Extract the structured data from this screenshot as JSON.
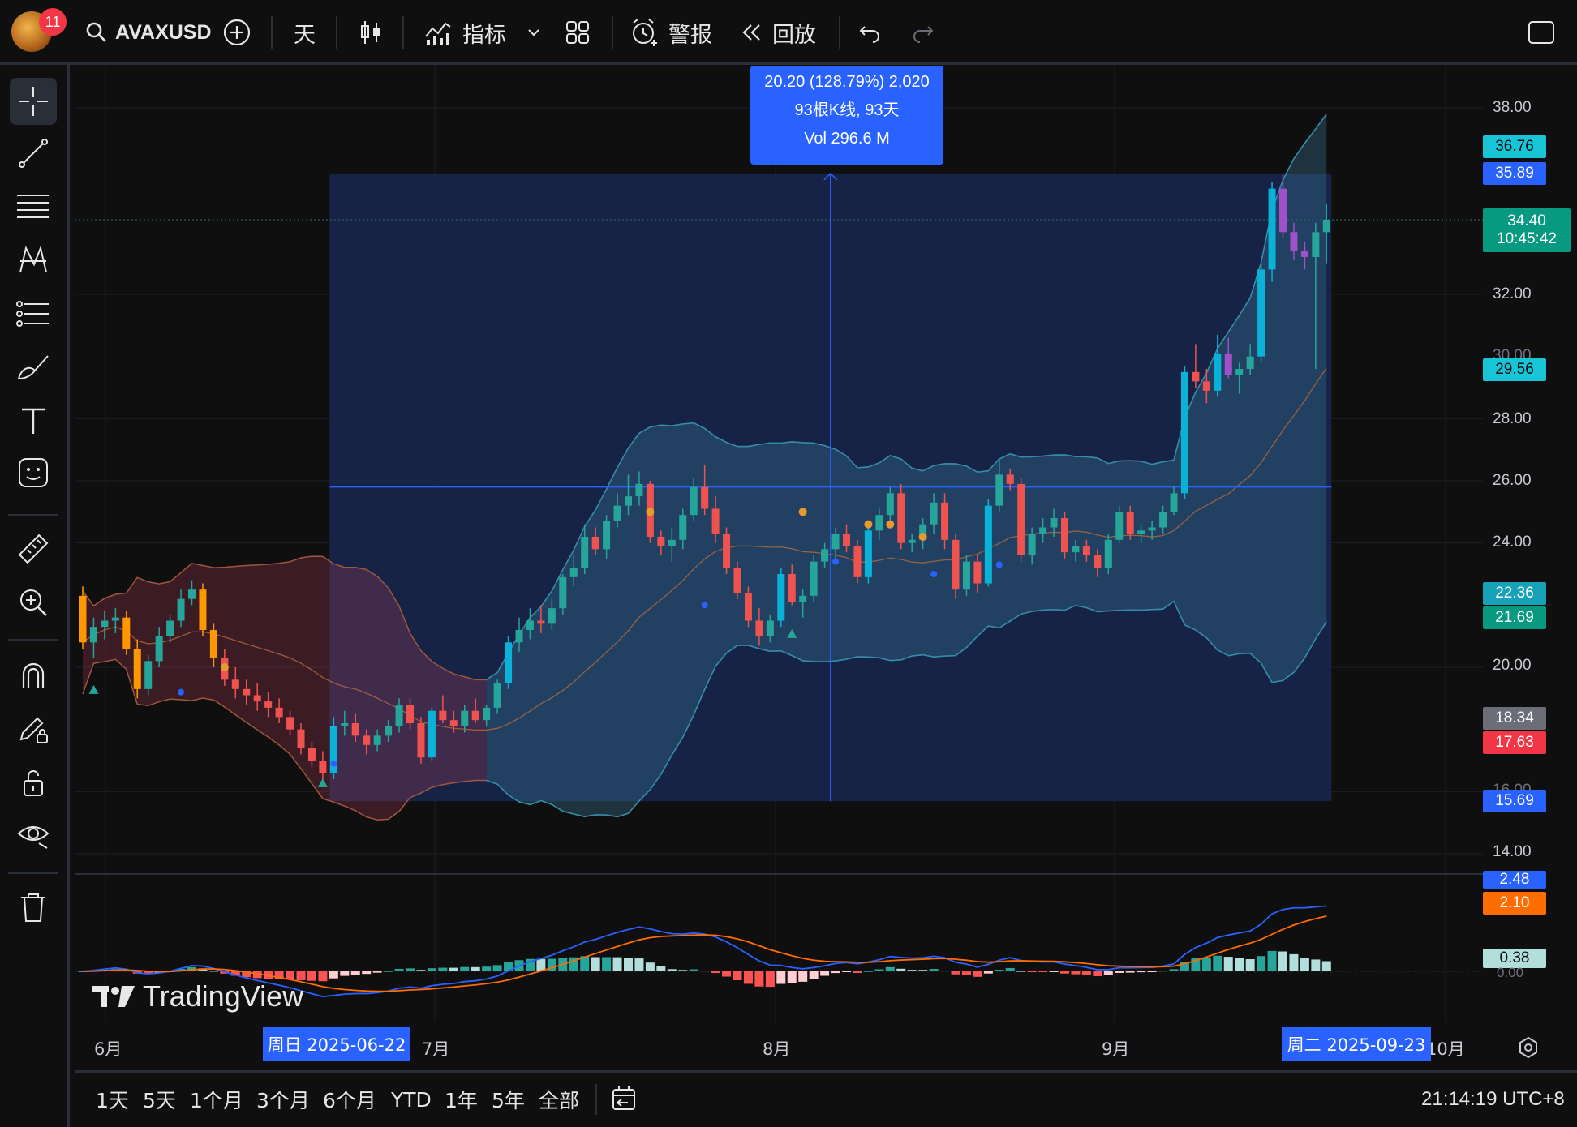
{
  "toolbar": {
    "notification_count": "11",
    "symbol": "AVAXUSD",
    "interval": "天",
    "indicators_label": "指标",
    "alert_label": "警报",
    "replay_label": "回放"
  },
  "measure": {
    "line1": "20.20 (128.79%) 2,020",
    "line2": "93根K线, 93天",
    "line3": "Vol 296.6 M"
  },
  "price_axis": {
    "ticks": [
      "38.00",
      "32.00",
      "30.00",
      "28.00",
      "26.00",
      "24.00",
      "20.00",
      "16.00",
      "14.00"
    ],
    "tags": {
      "t1": "36.76",
      "t2": "35.89",
      "t3": "34.40",
      "t3b": "10:45:42",
      "t4": "29.56",
      "t5": "22.36",
      "t6": "21.69",
      "t7": "18.34",
      "t8": "17.63",
      "t9": "15.69"
    },
    "macd_tags": {
      "m1": "2.48",
      "m2": "2.10",
      "m3": "0.38",
      "m4": "0.00"
    }
  },
  "time_axis": {
    "labels": [
      "6月",
      "7月",
      "8月",
      "9月",
      "10月"
    ],
    "range_start": "周日 2025-06-22",
    "range_end": "周二 2025-09-23"
  },
  "watermark": "TradingView",
  "bottom": {
    "ranges": [
      "1天",
      "5天",
      "1个月",
      "3个月",
      "6个月",
      "YTD",
      "1年",
      "5年",
      "全部"
    ],
    "clock": "21:14:19 UTC+8"
  },
  "colors": {
    "up": "#26a69a",
    "down": "#ef5350",
    "cyan": "#0ab2d8",
    "purple": "#a050c8",
    "orange": "#ff9800",
    "blue": "#2962ff",
    "measure_fill": "#17254a"
  },
  "chart_data": {
    "type": "candlestick",
    "symbol": "AVAXUSD",
    "range": {
      "start": "2025-06-22",
      "end": "2025-09-23"
    },
    "measure": {
      "change": 20.2,
      "change_pct": 128.79,
      "bars": 93,
      "days": 93,
      "volume": "296.6 M"
    },
    "candles": [
      [
        22.3,
        22.6,
        20.6,
        20.8
      ],
      [
        20.8,
        21.6,
        20.3,
        21.3
      ],
      [
        21.3,
        21.8,
        20.9,
        21.5
      ],
      [
        21.5,
        21.9,
        21.1,
        21.6
      ],
      [
        21.6,
        21.8,
        20.4,
        20.6
      ],
      [
        20.6,
        20.9,
        19.0,
        19.3
      ],
      [
        19.3,
        20.4,
        19.1,
        20.2
      ],
      [
        20.2,
        21.3,
        20.0,
        21.0
      ],
      [
        21.0,
        21.7,
        20.8,
        21.5
      ],
      [
        21.5,
        22.5,
        21.3,
        22.2
      ],
      [
        22.2,
        22.8,
        22.0,
        22.5
      ],
      [
        22.5,
        22.7,
        21.0,
        21.2
      ],
      [
        21.2,
        21.4,
        20.0,
        20.3
      ],
      [
        20.3,
        20.6,
        19.4,
        19.6
      ],
      [
        19.6,
        20.0,
        19.0,
        19.3
      ],
      [
        19.3,
        19.6,
        18.8,
        19.1
      ],
      [
        19.1,
        19.5,
        18.6,
        18.9
      ],
      [
        18.9,
        19.2,
        18.4,
        18.7
      ],
      [
        18.7,
        19.0,
        18.2,
        18.4
      ],
      [
        18.4,
        18.6,
        17.8,
        18.0
      ],
      [
        18.0,
        18.2,
        17.2,
        17.4
      ],
      [
        17.4,
        17.6,
        16.8,
        17.0
      ],
      [
        17.0,
        17.3,
        16.3,
        16.6
      ],
      [
        16.6,
        18.4,
        16.4,
        18.1
      ],
      [
        18.1,
        18.6,
        17.8,
        18.2
      ],
      [
        18.2,
        18.5,
        17.6,
        17.8
      ],
      [
        17.8,
        18.0,
        17.2,
        17.5
      ],
      [
        17.5,
        18.0,
        17.3,
        17.8
      ],
      [
        17.8,
        18.3,
        17.6,
        18.1
      ],
      [
        18.1,
        19.0,
        17.9,
        18.8
      ],
      [
        18.8,
        19.0,
        18.0,
        18.2
      ],
      [
        18.2,
        18.4,
        16.9,
        17.1
      ],
      [
        17.1,
        18.7,
        17.0,
        18.6
      ],
      [
        18.6,
        19.1,
        18.2,
        18.3
      ],
      [
        18.3,
        18.6,
        17.9,
        18.1
      ],
      [
        18.1,
        18.8,
        17.9,
        18.6
      ],
      [
        18.6,
        19.0,
        18.2,
        18.3
      ],
      [
        18.3,
        18.8,
        18.1,
        18.7
      ],
      [
        18.7,
        19.6,
        18.5,
        19.5
      ],
      [
        19.5,
        21.0,
        19.3,
        20.8
      ],
      [
        20.8,
        21.6,
        20.5,
        21.2
      ],
      [
        21.2,
        21.9,
        20.9,
        21.5
      ],
      [
        21.5,
        22.0,
        21.1,
        21.4
      ],
      [
        21.4,
        22.2,
        21.2,
        21.9
      ],
      [
        21.9,
        23.0,
        21.7,
        22.9
      ],
      [
        22.9,
        23.6,
        22.6,
        23.2
      ],
      [
        23.2,
        24.6,
        23.0,
        24.2
      ],
      [
        24.2,
        24.5,
        23.6,
        23.8
      ],
      [
        23.8,
        24.9,
        23.5,
        24.7
      ],
      [
        24.7,
        25.6,
        24.5,
        25.2
      ],
      [
        25.2,
        26.2,
        24.9,
        25.5
      ],
      [
        25.5,
        26.3,
        25.2,
        25.9
      ],
      [
        25.9,
        26.0,
        24.0,
        24.2
      ],
      [
        24.2,
        24.4,
        23.6,
        23.9
      ],
      [
        23.9,
        24.5,
        23.4,
        24.1
      ],
      [
        24.1,
        25.1,
        23.8,
        24.9
      ],
      [
        24.9,
        26.1,
        24.7,
        25.8
      ],
      [
        25.8,
        26.5,
        24.9,
        25.1
      ],
      [
        25.1,
        25.5,
        24.0,
        24.3
      ],
      [
        24.3,
        24.5,
        23.0,
        23.2
      ],
      [
        23.2,
        23.4,
        22.2,
        22.4
      ],
      [
        22.4,
        22.6,
        21.3,
        21.5
      ],
      [
        21.5,
        21.9,
        20.7,
        21.0
      ],
      [
        21.0,
        21.7,
        20.8,
        21.5
      ],
      [
        21.5,
        23.2,
        21.3,
        23.0
      ],
      [
        23.0,
        23.3,
        22.0,
        22.1
      ],
      [
        22.1,
        22.5,
        21.6,
        22.3
      ],
      [
        22.3,
        23.6,
        22.1,
        23.4
      ],
      [
        23.4,
        24.0,
        23.2,
        23.8
      ],
      [
        23.8,
        24.5,
        23.5,
        24.3
      ],
      [
        24.3,
        24.6,
        23.7,
        23.9
      ],
      [
        23.9,
        24.1,
        22.7,
        22.9
      ],
      [
        22.9,
        24.6,
        22.7,
        24.4
      ],
      [
        24.4,
        25.1,
        24.1,
        24.9
      ],
      [
        24.9,
        25.8,
        24.6,
        25.6
      ],
      [
        25.6,
        25.9,
        23.8,
        24.0
      ],
      [
        24.0,
        24.3,
        23.7,
        24.1
      ],
      [
        24.1,
        24.8,
        23.8,
        24.6
      ],
      [
        24.6,
        25.6,
        24.3,
        25.3
      ],
      [
        25.3,
        25.6,
        23.8,
        24.1
      ],
      [
        24.1,
        24.3,
        22.2,
        22.5
      ],
      [
        22.5,
        23.6,
        22.3,
        23.4
      ],
      [
        23.4,
        23.6,
        22.4,
        22.7
      ],
      [
        22.7,
        25.4,
        22.6,
        25.2
      ],
      [
        25.2,
        26.7,
        25.0,
        26.2
      ],
      [
        26.2,
        26.4,
        25.7,
        25.9
      ],
      [
        25.9,
        26.1,
        23.4,
        23.6
      ],
      [
        23.6,
        24.5,
        23.3,
        24.3
      ],
      [
        24.3,
        24.8,
        24.0,
        24.5
      ],
      [
        24.5,
        25.1,
        24.2,
        24.8
      ],
      [
        24.8,
        25.0,
        23.5,
        23.7
      ],
      [
        23.7,
        24.1,
        23.4,
        23.9
      ],
      [
        23.9,
        24.1,
        23.4,
        23.6
      ],
      [
        23.6,
        23.8,
        22.9,
        23.2
      ],
      [
        23.2,
        24.3,
        23.0,
        24.1
      ],
      [
        24.1,
        25.2,
        24.0,
        25.0
      ],
      [
        25.0,
        25.2,
        24.1,
        24.3
      ],
      [
        24.3,
        24.6,
        24.0,
        24.4
      ],
      [
        24.4,
        24.7,
        24.1,
        24.5
      ],
      [
        24.5,
        25.2,
        24.3,
        25.0
      ],
      [
        25.0,
        25.8,
        24.9,
        25.6
      ],
      [
        25.6,
        29.7,
        25.4,
        29.5
      ],
      [
        29.5,
        30.4,
        29.0,
        29.2
      ],
      [
        29.2,
        29.6,
        28.5,
        28.9
      ],
      [
        28.9,
        30.7,
        28.7,
        30.1
      ],
      [
        30.1,
        30.6,
        29.3,
        29.4
      ],
      [
        29.4,
        29.8,
        28.8,
        29.6
      ],
      [
        29.6,
        30.4,
        29.4,
        30.0
      ],
      [
        30.0,
        33.0,
        29.8,
        32.8
      ],
      [
        32.8,
        35.6,
        32.4,
        35.4
      ],
      [
        35.4,
        35.9,
        33.8,
        34.0
      ],
      [
        34.0,
        34.3,
        33.1,
        33.4
      ],
      [
        33.4,
        33.7,
        32.8,
        33.2
      ],
      [
        33.2,
        34.3,
        29.6,
        34.0
      ],
      [
        34.0,
        34.9,
        33.0,
        34.4
      ]
    ],
    "bollinger": {
      "upper_start": 25.5,
      "upper_end": 36.76,
      "lower_start": 20.5,
      "lower_end": 22.36
    },
    "macd": {
      "macd_last": 2.48,
      "signal_last": 2.1,
      "hist_last": 0.38
    }
  }
}
